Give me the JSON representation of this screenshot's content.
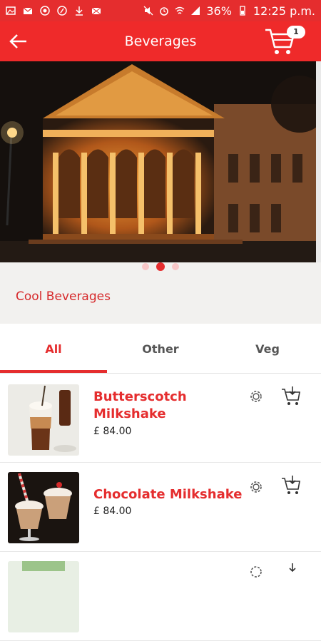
{
  "status_bar": {
    "battery": "36%",
    "time": "12:25 p.m."
  },
  "app_bar": {
    "title": "Beverages",
    "cart_count": "1"
  },
  "banner": {
    "page_count": 3,
    "active_page": 2
  },
  "category": {
    "name": "Cool Beverages"
  },
  "tabs": [
    {
      "label": "All"
    },
    {
      "label": "Other"
    },
    {
      "label": "Veg"
    }
  ],
  "items": [
    {
      "name": "Butterscotch Milkshake",
      "price": "£ 84.00"
    },
    {
      "name": "Chocolate Milkshake",
      "price": "£ 84.00"
    }
  ],
  "colors": {
    "accent": "#e52d2e",
    "panel": "#f2f1ef"
  }
}
